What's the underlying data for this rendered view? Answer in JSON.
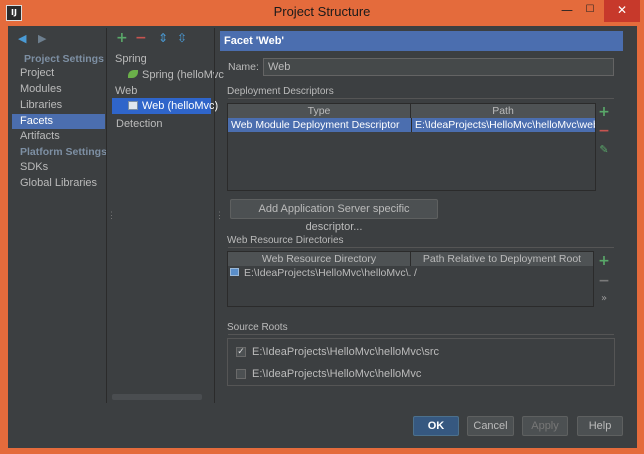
{
  "window": {
    "title": "Project Structure",
    "app_icon": "IJ",
    "minimize_icon": "—",
    "maximize_icon": "☐",
    "close_icon": "✕"
  },
  "sidebar": {
    "back_icon": "◀",
    "forward_icon": "▶",
    "sections": {
      "project_settings": "Project Settings",
      "platform_settings": "Platform Settings"
    },
    "items": [
      {
        "label": "Project"
      },
      {
        "label": "Modules"
      },
      {
        "label": "Libraries"
      },
      {
        "label": "Facets",
        "selected": true
      },
      {
        "label": "Artifacts"
      },
      {
        "label": "SDKs"
      },
      {
        "label": "Global Libraries"
      }
    ]
  },
  "facet_tree": {
    "add_icon": "+",
    "remove_icon": "−",
    "expand_icon": "⇕",
    "collapse_icon": "⇳",
    "nodes": [
      {
        "label": "Spring",
        "level": 0
      },
      {
        "label": "Spring (helloMvc",
        "level": 1,
        "icon": "spring-leaf-icon"
      },
      {
        "label": "Web",
        "level": 0
      },
      {
        "label": "Web (helloMvc)",
        "level": 1,
        "icon": "web-facet-icon",
        "selected": true
      },
      {
        "label": "Detection",
        "level": 0
      }
    ]
  },
  "facet_panel": {
    "header": "Facet 'Web'",
    "name_label": "Name:",
    "name_value": "Web",
    "deployment_descriptors": {
      "title": "Deployment Descriptors",
      "columns": [
        "Type",
        "Path"
      ],
      "rows": [
        {
          "type": "Web Module Deployment Descriptor",
          "path": "E:\\IdeaProjects\\HelloMvc\\helloMvc\\web\\"
        }
      ],
      "add_icon": "+",
      "remove_icon": "−",
      "edit_icon": "✎",
      "add_server_button": "Add Application Server specific descriptor..."
    },
    "web_resource_directories": {
      "title": "Web Resource Directories",
      "columns": [
        "Web Resource Directory",
        "Path Relative to Deployment Root"
      ],
      "rows": [
        {
          "directory": "E:\\IdeaProjects\\HelloMvc\\helloMvc\\...",
          "relative": "/"
        }
      ],
      "add_icon": "+",
      "remove_icon": "−",
      "more_icon": "»"
    },
    "source_roots": {
      "title": "Source Roots",
      "items": [
        {
          "path": "E:\\IdeaProjects\\HelloMvc\\helloMvc\\src",
          "checked": true
        },
        {
          "path": "E:\\IdeaProjects\\HelloMvc\\helloMvc",
          "checked": false
        }
      ]
    }
  },
  "footer": {
    "ok": "OK",
    "cancel": "Cancel",
    "apply": "Apply",
    "help": "Help"
  },
  "colors": {
    "title_bar": "#e46b3c",
    "background": "#3c3f41",
    "selection": "#4b6eaf",
    "add_green": "#59a869",
    "remove_red": "#c75450"
  }
}
